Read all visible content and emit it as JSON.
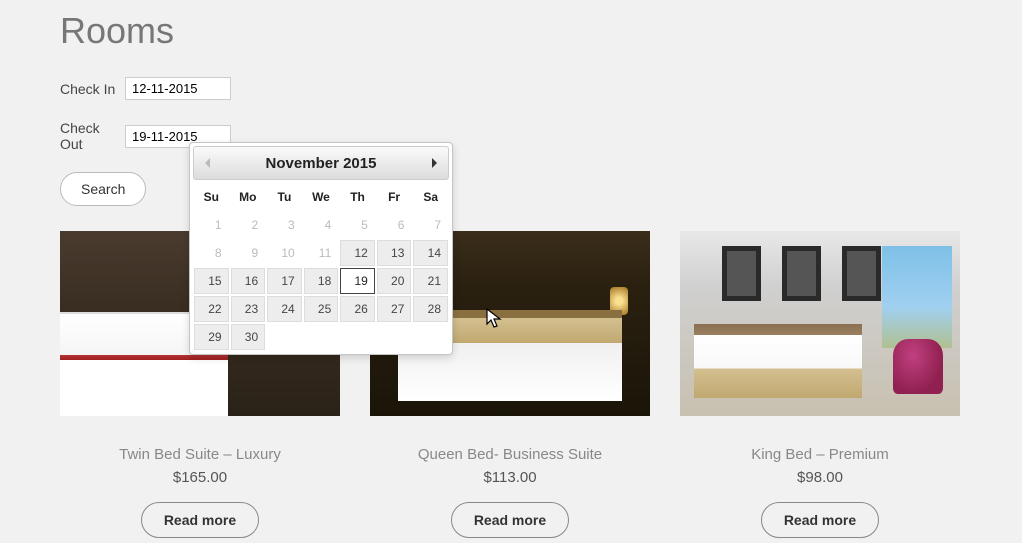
{
  "page_title": "Rooms",
  "form": {
    "checkin_label": "Check In",
    "checkin_value": "12-11-2015",
    "checkout_label": "Check Out",
    "checkout_value": "19-11-2015",
    "search_label": "Search"
  },
  "datepicker": {
    "title": "November 2015",
    "dow": [
      "Su",
      "Mo",
      "Tu",
      "We",
      "Th",
      "Fr",
      "Sa"
    ],
    "weeks": [
      [
        {
          "d": "1",
          "s": "d"
        },
        {
          "d": "2",
          "s": "d"
        },
        {
          "d": "3",
          "s": "d"
        },
        {
          "d": "4",
          "s": "d"
        },
        {
          "d": "5",
          "s": "d"
        },
        {
          "d": "6",
          "s": "d"
        },
        {
          "d": "7",
          "s": "d"
        }
      ],
      [
        {
          "d": "8",
          "s": "d"
        },
        {
          "d": "9",
          "s": "d"
        },
        {
          "d": "10",
          "s": "d"
        },
        {
          "d": "11",
          "s": "d"
        },
        {
          "d": "12",
          "s": "e"
        },
        {
          "d": "13",
          "s": "e"
        },
        {
          "d": "14",
          "s": "e"
        }
      ],
      [
        {
          "d": "15",
          "s": "e"
        },
        {
          "d": "16",
          "s": "e"
        },
        {
          "d": "17",
          "s": "e"
        },
        {
          "d": "18",
          "s": "e"
        },
        {
          "d": "19",
          "s": "sel"
        },
        {
          "d": "20",
          "s": "e"
        },
        {
          "d": "21",
          "s": "e"
        }
      ],
      [
        {
          "d": "22",
          "s": "e"
        },
        {
          "d": "23",
          "s": "e"
        },
        {
          "d": "24",
          "s": "e"
        },
        {
          "d": "25",
          "s": "e"
        },
        {
          "d": "26",
          "s": "e"
        },
        {
          "d": "27",
          "s": "e"
        },
        {
          "d": "28",
          "s": "e"
        }
      ],
      [
        {
          "d": "29",
          "s": "e"
        },
        {
          "d": "30",
          "s": "e"
        },
        {
          "d": "",
          "s": "x"
        },
        {
          "d": "",
          "s": "x"
        },
        {
          "d": "",
          "s": "x"
        },
        {
          "d": "",
          "s": "x"
        },
        {
          "d": "",
          "s": "x"
        }
      ]
    ]
  },
  "products": [
    {
      "title": "Twin Bed Suite – Luxury",
      "price": "$165.00",
      "btn": "Read more"
    },
    {
      "title": "Queen Bed- Business Suite",
      "price": "$113.00",
      "btn": "Read more"
    },
    {
      "title": "King Bed – Premium",
      "price": "$98.00",
      "btn": "Read more"
    }
  ]
}
